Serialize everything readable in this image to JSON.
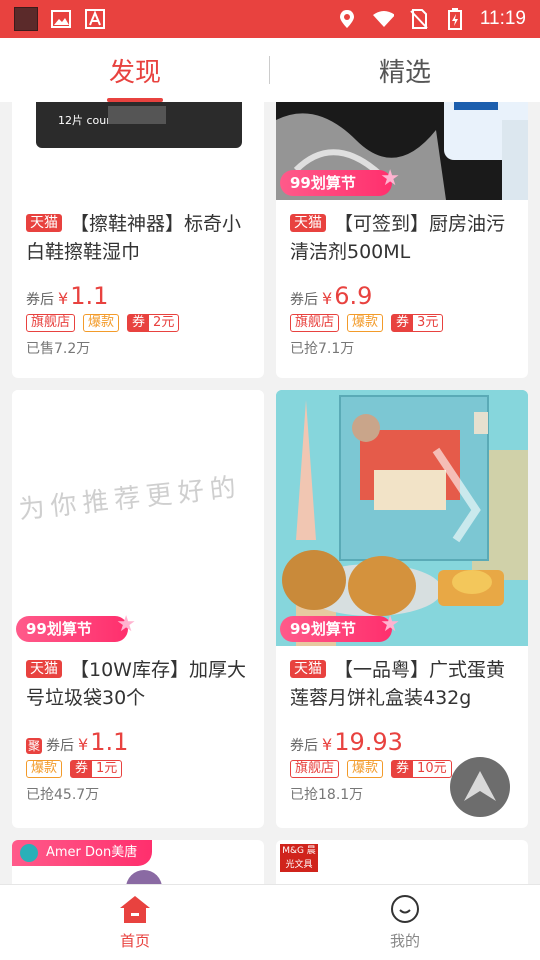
{
  "status_bar": {
    "time": "11:19"
  },
  "top_tabs": [
    {
      "label": "发现",
      "active": true
    },
    {
      "label": "精选",
      "active": false
    }
  ],
  "cards": [
    {
      "tmall": "天猫",
      "title": "【擦鞋神器】标奇小白鞋擦鞋湿巾",
      "after_coupon": "券后",
      "currency": "¥",
      "price": "1.1",
      "tags": {
        "flagship": "旗舰店",
        "hot": "爆款",
        "coupon_label": "券",
        "coupon_value": "2元"
      },
      "sold": "已售7.2万",
      "image_text": "12片 counts"
    },
    {
      "tmall": "天猫",
      "title": "【可签到】厨房油污清洁剂500ML",
      "after_coupon": "券后",
      "currency": "¥",
      "price": "6.9",
      "tags": {
        "flagship": "旗舰店",
        "hot": "爆款",
        "coupon_label": "券",
        "coupon_value": "3元"
      },
      "sold": "已抢7.1万",
      "festival_badge": "99划算节"
    },
    {
      "tmall": "天猫",
      "title": "【10W库存】加厚大号垃圾袋30个",
      "ju": "聚",
      "after_coupon": "券后",
      "currency": "¥",
      "price": "1.1",
      "tags": {
        "hot": "爆款",
        "coupon_label": "券",
        "coupon_value": "1元"
      },
      "sold": "已抢45.7万",
      "placeholder_text": "为你推荐更好的",
      "festival_badge": "99划算节"
    },
    {
      "tmall": "天猫",
      "title": "【一品粤】广式蛋黄莲蓉月饼礼盒装432g",
      "after_coupon": "券后",
      "currency": "¥",
      "price": "19.93",
      "tags": {
        "flagship": "旗舰店",
        "hot": "爆款",
        "coupon_label": "券",
        "coupon_value": "10元"
      },
      "sold": "已抢18.1万",
      "festival_badge": "99划算节"
    }
  ],
  "partial_cards": [
    {
      "brand": "Amer Don美唐"
    },
    {
      "brand": "M&G 晨光文具"
    }
  ],
  "bottom_nav": [
    {
      "label": "首页",
      "icon": "home-icon",
      "active": true
    },
    {
      "label": "我的",
      "icon": "profile-icon",
      "active": false
    }
  ],
  "colors": {
    "accent": "#e8423f",
    "hot": "#f39b2a"
  }
}
